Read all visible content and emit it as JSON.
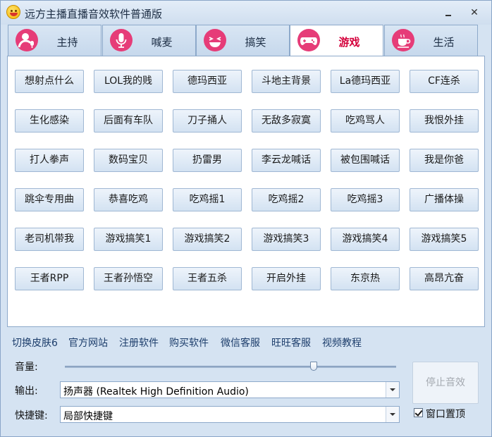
{
  "window": {
    "title": "远方主播直播音效软件普通版",
    "minimize": "",
    "close": "✕"
  },
  "tabs": [
    {
      "label": "主持",
      "icon": "person-mic-icon",
      "active": false
    },
    {
      "label": "喊麦",
      "icon": "microphone-icon",
      "active": false
    },
    {
      "label": "搞笑",
      "icon": "laughing-face-icon",
      "active": false
    },
    {
      "label": "游戏",
      "icon": "gamepad-icon",
      "active": true
    },
    {
      "label": "生活",
      "icon": "coffee-cup-icon",
      "active": false
    }
  ],
  "sound_buttons": [
    [
      "想射点什么",
      "LOL我的贱",
      "德玛西亚",
      "斗地主背景",
      "La德玛西亚",
      "CF连杀"
    ],
    [
      "生化感染",
      "后面有车队",
      "刀子捅人",
      "无敌多寂寞",
      "吃鸡骂人",
      "我恨外挂"
    ],
    [
      "打人拳声",
      "数码宝贝",
      "扔雷男",
      "李云龙喊话",
      "被包围喊话",
      "我是你爸"
    ],
    [
      "跳伞专用曲",
      "恭喜吃鸡",
      "吃鸡摇1",
      "吃鸡摇2",
      "吃鸡摇3",
      "广播体操"
    ],
    [
      "老司机带我",
      "游戏搞笑1",
      "游戏搞笑2",
      "游戏搞笑3",
      "游戏搞笑4",
      "游戏搞笑5"
    ],
    [
      "王者RPP",
      "王者孙悟空",
      "王者五杀",
      "开启外挂",
      "东京热",
      "高昂亢奋"
    ]
  ],
  "links": [
    "切换皮肤6",
    "官方网站",
    "注册软件",
    "购买软件",
    "微信客服",
    "旺旺客服",
    "视频教程"
  ],
  "controls": {
    "volume_label": "音量:",
    "volume_level": 0.75,
    "output_label": "输出:",
    "output_value": "扬声器 (Realtek High Definition Audio)",
    "hotkey_label": "快捷键:",
    "hotkey_value": "局部快捷键",
    "stop_button": "停止音效",
    "pin_label": "窗口置顶",
    "pin_checked": true
  },
  "colors": {
    "accent_pink": "#e63c78",
    "active_tab_text": "#d4003b",
    "window_bg": "#d5e3f2"
  }
}
